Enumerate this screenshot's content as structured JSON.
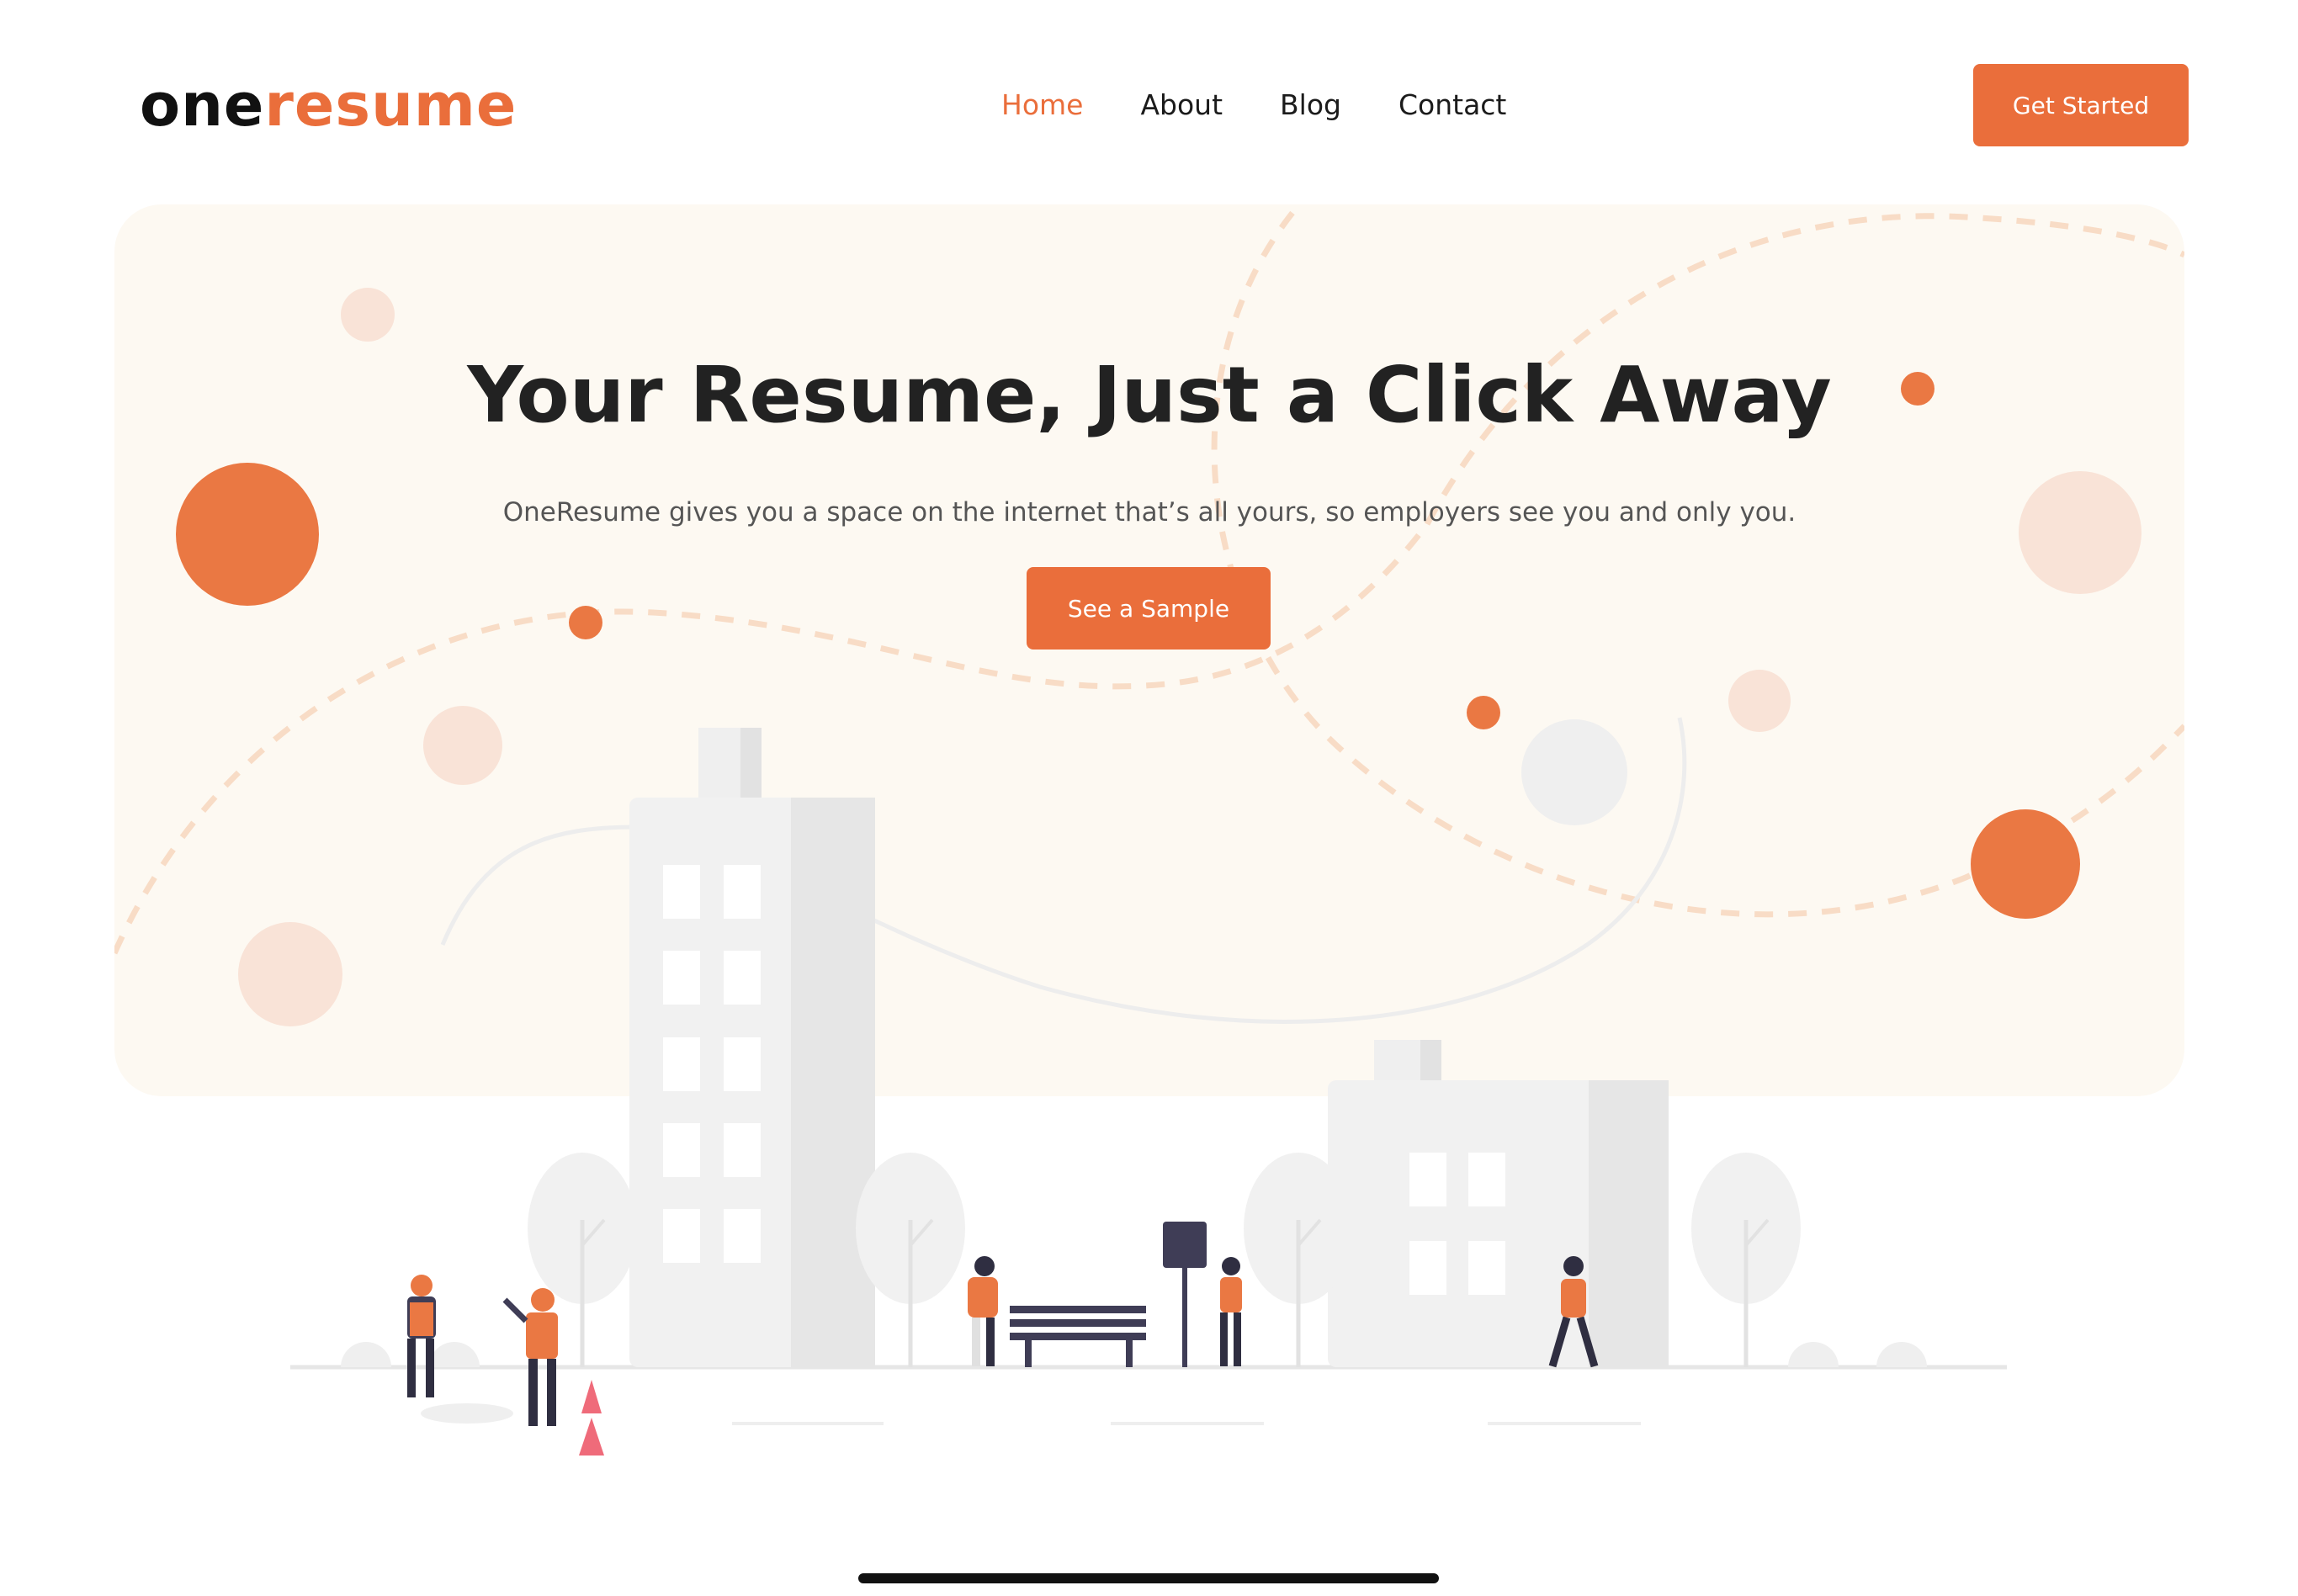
{
  "brand": {
    "logo_part1": "one",
    "logo_part2": "resume",
    "accent_color": "#ea6e3b",
    "dark_color": "#111111"
  },
  "nav": {
    "items": [
      {
        "label": "Home",
        "active": true
      },
      {
        "label": "About",
        "active": false
      },
      {
        "label": "Blog",
        "active": false
      },
      {
        "label": "Contact",
        "active": false
      }
    ]
  },
  "header": {
    "cta_label": "Get Started"
  },
  "hero": {
    "title": "Your Resume, Just a Click Away",
    "subtitle": "OneResume gives you a space on the internet that’s all yours, so employers see you and only you.",
    "button_label": "See a Sample",
    "background_color": "#fdf9f2"
  },
  "illustration": {
    "icon": "city-construction-illustration"
  }
}
